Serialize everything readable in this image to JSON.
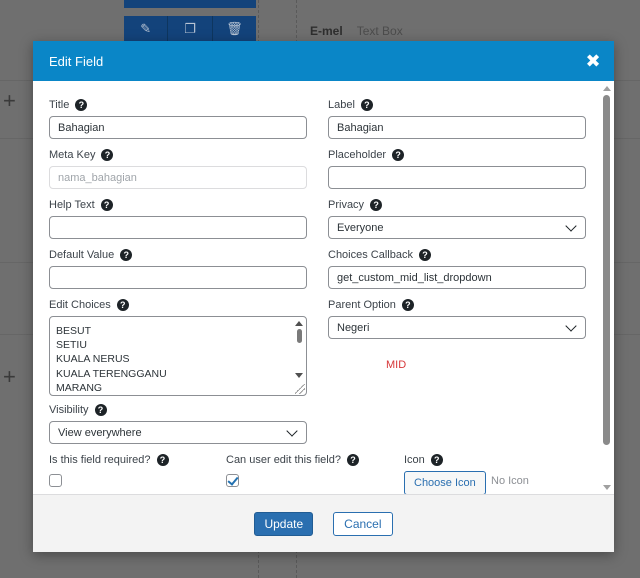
{
  "background": {
    "field_key": "E-mel",
    "field_type": "Text Box"
  },
  "modal": {
    "title": "Edit Field",
    "close_symbol": "✖"
  },
  "fields": {
    "title": {
      "label": "Title",
      "value": "Bahagian"
    },
    "label": {
      "label": "Label",
      "value": "Bahagian"
    },
    "meta_key": {
      "label": "Meta Key",
      "placeholder": "nama_bahagian"
    },
    "placeholder": {
      "label": "Placeholder",
      "value": ""
    },
    "help_text": {
      "label": "Help Text",
      "value": ""
    },
    "privacy": {
      "label": "Privacy",
      "selected": "Everyone"
    },
    "default_value": {
      "label": "Default Value",
      "value": ""
    },
    "choices_callback": {
      "label": "Choices Callback",
      "value": "get_custom_mid_list_dropdown"
    },
    "edit_choices": {
      "label": "Edit Choices",
      "lines": [
        "BESUT",
        "SETIU",
        "KUALA NERUS",
        "KUALA TERENGGANU",
        "MARANG"
      ]
    },
    "parent_option": {
      "label": "Parent Option",
      "selected": "Negeri"
    },
    "mid_note": "MID",
    "visibility": {
      "label": "Visibility",
      "selected": "View everywhere"
    },
    "required": {
      "label": "Is this field required?",
      "checked": false
    },
    "editable": {
      "label": "Can user edit this field?",
      "checked": true
    },
    "icon": {
      "label": "Icon",
      "button": "Choose Icon",
      "status": "No Icon"
    }
  },
  "footer": {
    "update": "Update",
    "cancel": "Cancel"
  },
  "colors": {
    "header": "#0a86c7",
    "primary": "#2a6fb0",
    "mid_note": "#d63638"
  }
}
